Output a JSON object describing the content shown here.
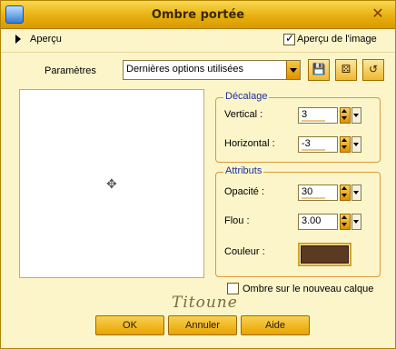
{
  "window": {
    "title": "Ombre portée"
  },
  "toolbar": {
    "apercu_label": "Aperçu",
    "apercu_image_label": "Aperçu de l'image",
    "apercu_image_checked": true
  },
  "parametres": {
    "label": "Paramètres",
    "preset_value": "Dernières options utilisées"
  },
  "decalage": {
    "title": "Décalage",
    "vertical_label": "Vertical :",
    "vertical_value": "3",
    "horizontal_label": "Horizontal :",
    "horizontal_value": "-3"
  },
  "attributs": {
    "title": "Attributs",
    "opacite_label": "Opacité :",
    "opacite_value": "30",
    "flou_label": "Flou :",
    "flou_value": "3.00",
    "couleur_label": "Couleur :",
    "couleur_hex": "#5a3a20"
  },
  "ombre_nouveau_calque": {
    "label": "Ombre sur le nouveau calque",
    "checked": false
  },
  "logo_text": "Titoune",
  "buttons": {
    "ok": "OK",
    "annuler": "Annuler",
    "aide": "Aide"
  },
  "icons": {
    "app": "app-icon",
    "close": "close-icon",
    "save": "save-preset-icon",
    "randomize": "randomize-icon",
    "reset": "reset-icon"
  },
  "colors": {
    "titlebar": "#e8b010",
    "panel": "#fbf5c9",
    "group_title": "#1a2fa0"
  }
}
